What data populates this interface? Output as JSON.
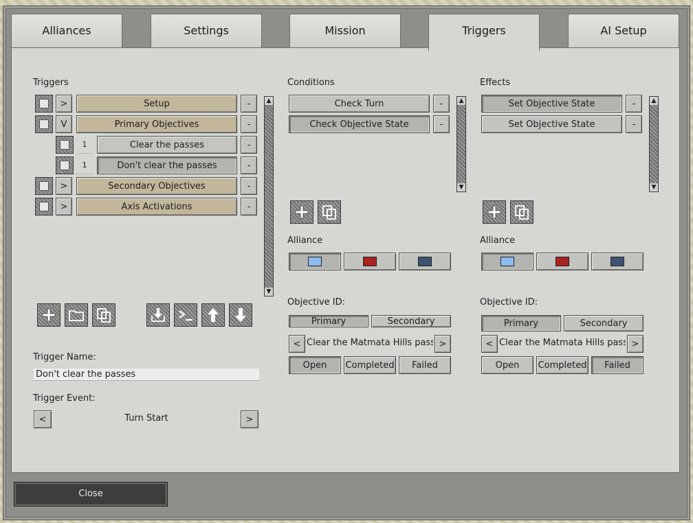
{
  "tabs": [
    "Alliances",
    "Settings",
    "Mission",
    "Triggers",
    "AI Setup"
  ],
  "active_tab": "Triggers",
  "triggers": {
    "section_label": "Triggers",
    "items": [
      {
        "toggle": ">",
        "label": "Setup",
        "remove": "-"
      },
      {
        "toggle": "V",
        "label": "Primary Objectives",
        "remove": "-"
      },
      {
        "num": "1",
        "label": "Clear the passes",
        "remove": "-"
      },
      {
        "num": "1",
        "label": "Don't clear the passes",
        "remove": "-"
      },
      {
        "toggle": ">",
        "label": "Secondary Objectives",
        "remove": "-"
      },
      {
        "toggle": ">",
        "label": "Axis Activations",
        "remove": "-"
      }
    ],
    "toolbar_icons": [
      "add-icon",
      "folder-icon",
      "copy-icon",
      "import-icon",
      "console-icon",
      "move-up-icon",
      "move-down-icon"
    ],
    "name_label": "Trigger Name:",
    "name_value": "Don't clear the passes",
    "event_label": "Trigger Event:",
    "event_prev": "<",
    "event_value": "Turn Start",
    "event_next": ">"
  },
  "conditions": {
    "section_label": "Conditions",
    "items": [
      {
        "label": "Check Turn",
        "remove": "-"
      },
      {
        "label": "Check Objective State",
        "remove": "-"
      }
    ],
    "alliance_label": "Alliance",
    "objective_id_label": "Objective ID:",
    "primary": "Primary",
    "secondary": "Secondary",
    "prev": "<",
    "objective_value": "Clear the Matmata Hills passes",
    "next": ">",
    "states": [
      "Open",
      "Completed",
      "Failed"
    ]
  },
  "effects": {
    "section_label": "Effects",
    "items": [
      {
        "label": "Set Objective State",
        "remove": "-"
      },
      {
        "label": "Set Objective State",
        "remove": "-"
      }
    ],
    "alliance_label": "Alliance",
    "objective_id_label": "Objective ID:",
    "primary": "Primary",
    "secondary": "Secondary",
    "prev": "<",
    "objective_value": "Clear the Matmata Hills passes",
    "next": ">",
    "states": [
      "Open",
      "Completed",
      "Failed"
    ]
  },
  "alliance_colors": [
    "#8fbcf0",
    "#a82222",
    "#3c5470"
  ],
  "close_label": "Close"
}
